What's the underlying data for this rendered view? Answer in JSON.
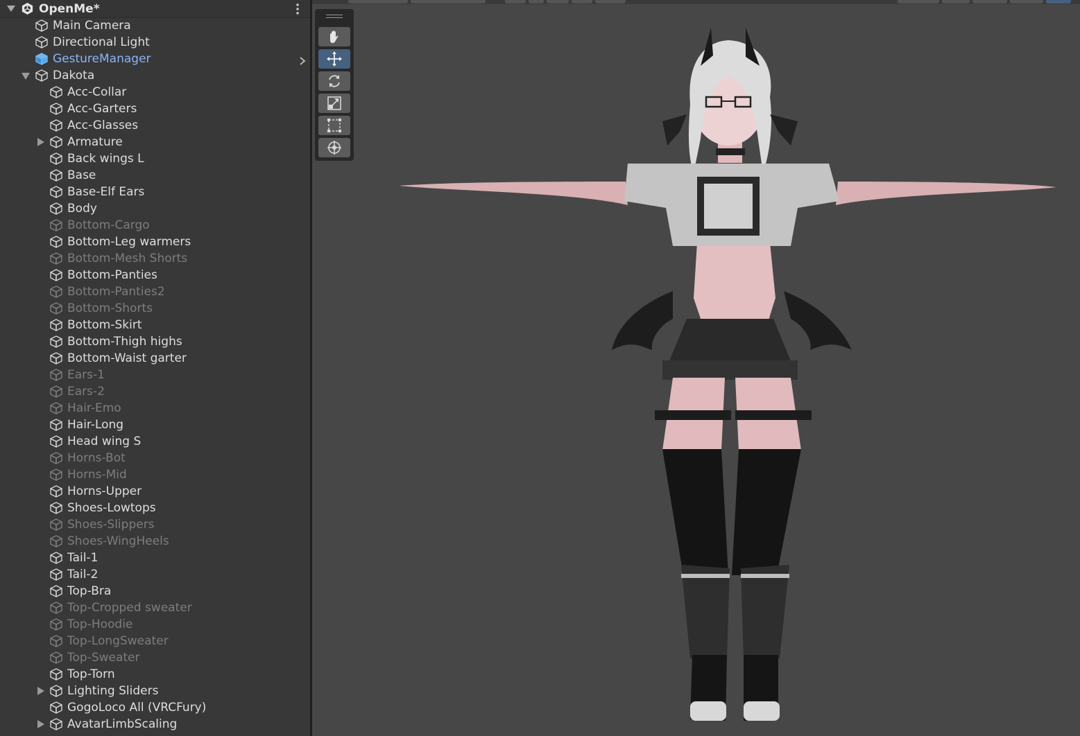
{
  "hierarchy": {
    "scene_name": "OpenMe*",
    "items": [
      {
        "label": "Main Camera",
        "depth": 0,
        "active": true,
        "expand": "none",
        "prefab": false
      },
      {
        "label": "Directional Light",
        "depth": 0,
        "active": true,
        "expand": "none",
        "prefab": false
      },
      {
        "label": "GestureManager",
        "depth": 0,
        "active": true,
        "expand": "none",
        "prefab": true
      },
      {
        "label": "Dakota",
        "depth": 0,
        "active": true,
        "expand": "expanded",
        "prefab": false
      },
      {
        "label": "Acc-Collar",
        "depth": 1,
        "active": true,
        "expand": "none",
        "prefab": false
      },
      {
        "label": "Acc-Garters",
        "depth": 1,
        "active": true,
        "expand": "none",
        "prefab": false
      },
      {
        "label": "Acc-Glasses",
        "depth": 1,
        "active": true,
        "expand": "none",
        "prefab": false
      },
      {
        "label": "Armature",
        "depth": 1,
        "active": true,
        "expand": "collapsed",
        "prefab": false
      },
      {
        "label": "Back wings L",
        "depth": 1,
        "active": true,
        "expand": "none",
        "prefab": false
      },
      {
        "label": "Base",
        "depth": 1,
        "active": true,
        "expand": "none",
        "prefab": false
      },
      {
        "label": "Base-Elf Ears",
        "depth": 1,
        "active": true,
        "expand": "none",
        "prefab": false
      },
      {
        "label": "Body",
        "depth": 1,
        "active": true,
        "expand": "none",
        "prefab": false
      },
      {
        "label": "Bottom-Cargo",
        "depth": 1,
        "active": false,
        "expand": "none",
        "prefab": false
      },
      {
        "label": "Bottom-Leg warmers",
        "depth": 1,
        "active": true,
        "expand": "none",
        "prefab": false
      },
      {
        "label": "Bottom-Mesh Shorts",
        "depth": 1,
        "active": false,
        "expand": "none",
        "prefab": false
      },
      {
        "label": "Bottom-Panties",
        "depth": 1,
        "active": true,
        "expand": "none",
        "prefab": false
      },
      {
        "label": "Bottom-Panties2",
        "depth": 1,
        "active": false,
        "expand": "none",
        "prefab": false
      },
      {
        "label": "Bottom-Shorts",
        "depth": 1,
        "active": false,
        "expand": "none",
        "prefab": false
      },
      {
        "label": "Bottom-Skirt",
        "depth": 1,
        "active": true,
        "expand": "none",
        "prefab": false
      },
      {
        "label": "Bottom-Thigh highs",
        "depth": 1,
        "active": true,
        "expand": "none",
        "prefab": false
      },
      {
        "label": "Bottom-Waist garter",
        "depth": 1,
        "active": true,
        "expand": "none",
        "prefab": false
      },
      {
        "label": "Ears-1",
        "depth": 1,
        "active": false,
        "expand": "none",
        "prefab": false
      },
      {
        "label": "Ears-2",
        "depth": 1,
        "active": false,
        "expand": "none",
        "prefab": false
      },
      {
        "label": "Hair-Emo",
        "depth": 1,
        "active": false,
        "expand": "none",
        "prefab": false
      },
      {
        "label": "Hair-Long",
        "depth": 1,
        "active": true,
        "expand": "none",
        "prefab": false
      },
      {
        "label": "Head wing S",
        "depth": 1,
        "active": true,
        "expand": "none",
        "prefab": false
      },
      {
        "label": "Horns-Bot",
        "depth": 1,
        "active": false,
        "expand": "none",
        "prefab": false
      },
      {
        "label": "Horns-Mid",
        "depth": 1,
        "active": false,
        "expand": "none",
        "prefab": false
      },
      {
        "label": "Horns-Upper",
        "depth": 1,
        "active": true,
        "expand": "none",
        "prefab": false
      },
      {
        "label": "Shoes-Lowtops",
        "depth": 1,
        "active": true,
        "expand": "none",
        "prefab": false
      },
      {
        "label": "Shoes-Slippers",
        "depth": 1,
        "active": false,
        "expand": "none",
        "prefab": false
      },
      {
        "label": "Shoes-WingHeels",
        "depth": 1,
        "active": false,
        "expand": "none",
        "prefab": false
      },
      {
        "label": "Tail-1",
        "depth": 1,
        "active": true,
        "expand": "none",
        "prefab": false
      },
      {
        "label": "Tail-2",
        "depth": 1,
        "active": true,
        "expand": "none",
        "prefab": false
      },
      {
        "label": "Top-Bra",
        "depth": 1,
        "active": true,
        "expand": "none",
        "prefab": false
      },
      {
        "label": "Top-Cropped sweater",
        "depth": 1,
        "active": false,
        "expand": "none",
        "prefab": false
      },
      {
        "label": "Top-Hoodie",
        "depth": 1,
        "active": false,
        "expand": "none",
        "prefab": false
      },
      {
        "label": "Top-LongSweater",
        "depth": 1,
        "active": false,
        "expand": "none",
        "prefab": false
      },
      {
        "label": "Top-Sweater",
        "depth": 1,
        "active": false,
        "expand": "none",
        "prefab": false
      },
      {
        "label": "Top-Torn",
        "depth": 1,
        "active": true,
        "expand": "none",
        "prefab": false
      },
      {
        "label": "Lighting Sliders",
        "depth": 1,
        "active": true,
        "expand": "collapsed",
        "prefab": false
      },
      {
        "label": "GogoLoco All (VRCFury)",
        "depth": 1,
        "active": true,
        "expand": "none",
        "prefab": false
      },
      {
        "label": "AvatarLimbScaling",
        "depth": 1,
        "active": true,
        "expand": "collapsed",
        "prefab": false
      }
    ]
  },
  "scene_view": {
    "tools": [
      {
        "name": "hand-tool",
        "icon": "hand-icon",
        "active": false
      },
      {
        "name": "move-tool",
        "icon": "move-icon",
        "active": true
      },
      {
        "name": "rotate-tool",
        "icon": "rotate-icon",
        "active": false
      },
      {
        "name": "scale-tool",
        "icon": "scale-icon",
        "active": false
      },
      {
        "name": "rect-tool",
        "icon": "rect-icon",
        "active": false
      },
      {
        "name": "transform-tool",
        "icon": "transform-icon",
        "active": false
      }
    ],
    "background_color": "#474747",
    "accent_color": "#46607f"
  }
}
